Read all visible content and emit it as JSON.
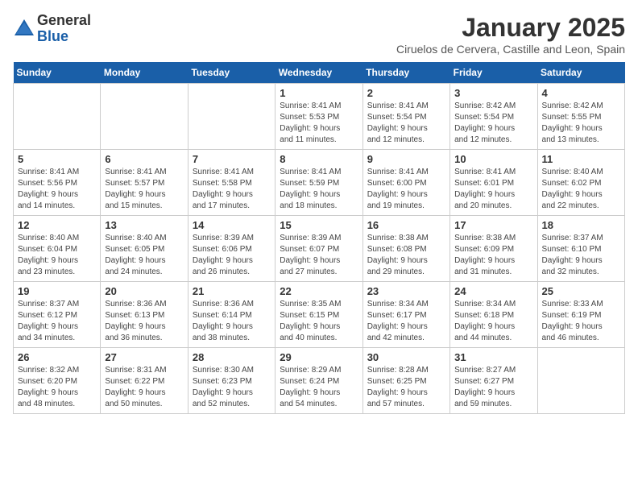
{
  "header": {
    "logo_general": "General",
    "logo_blue": "Blue",
    "month": "January 2025",
    "location": "Ciruelos de Cervera, Castille and Leon, Spain"
  },
  "weekdays": [
    "Sunday",
    "Monday",
    "Tuesday",
    "Wednesday",
    "Thursday",
    "Friday",
    "Saturday"
  ],
  "weeks": [
    [
      {
        "day": "",
        "info": ""
      },
      {
        "day": "",
        "info": ""
      },
      {
        "day": "",
        "info": ""
      },
      {
        "day": "1",
        "info": "Sunrise: 8:41 AM\nSunset: 5:53 PM\nDaylight: 9 hours\nand 11 minutes."
      },
      {
        "day": "2",
        "info": "Sunrise: 8:41 AM\nSunset: 5:54 PM\nDaylight: 9 hours\nand 12 minutes."
      },
      {
        "day": "3",
        "info": "Sunrise: 8:42 AM\nSunset: 5:54 PM\nDaylight: 9 hours\nand 12 minutes."
      },
      {
        "day": "4",
        "info": "Sunrise: 8:42 AM\nSunset: 5:55 PM\nDaylight: 9 hours\nand 13 minutes."
      }
    ],
    [
      {
        "day": "5",
        "info": "Sunrise: 8:41 AM\nSunset: 5:56 PM\nDaylight: 9 hours\nand 14 minutes."
      },
      {
        "day": "6",
        "info": "Sunrise: 8:41 AM\nSunset: 5:57 PM\nDaylight: 9 hours\nand 15 minutes."
      },
      {
        "day": "7",
        "info": "Sunrise: 8:41 AM\nSunset: 5:58 PM\nDaylight: 9 hours\nand 17 minutes."
      },
      {
        "day": "8",
        "info": "Sunrise: 8:41 AM\nSunset: 5:59 PM\nDaylight: 9 hours\nand 18 minutes."
      },
      {
        "day": "9",
        "info": "Sunrise: 8:41 AM\nSunset: 6:00 PM\nDaylight: 9 hours\nand 19 minutes."
      },
      {
        "day": "10",
        "info": "Sunrise: 8:41 AM\nSunset: 6:01 PM\nDaylight: 9 hours\nand 20 minutes."
      },
      {
        "day": "11",
        "info": "Sunrise: 8:40 AM\nSunset: 6:02 PM\nDaylight: 9 hours\nand 22 minutes."
      }
    ],
    [
      {
        "day": "12",
        "info": "Sunrise: 8:40 AM\nSunset: 6:04 PM\nDaylight: 9 hours\nand 23 minutes."
      },
      {
        "day": "13",
        "info": "Sunrise: 8:40 AM\nSunset: 6:05 PM\nDaylight: 9 hours\nand 24 minutes."
      },
      {
        "day": "14",
        "info": "Sunrise: 8:39 AM\nSunset: 6:06 PM\nDaylight: 9 hours\nand 26 minutes."
      },
      {
        "day": "15",
        "info": "Sunrise: 8:39 AM\nSunset: 6:07 PM\nDaylight: 9 hours\nand 27 minutes."
      },
      {
        "day": "16",
        "info": "Sunrise: 8:38 AM\nSunset: 6:08 PM\nDaylight: 9 hours\nand 29 minutes."
      },
      {
        "day": "17",
        "info": "Sunrise: 8:38 AM\nSunset: 6:09 PM\nDaylight: 9 hours\nand 31 minutes."
      },
      {
        "day": "18",
        "info": "Sunrise: 8:37 AM\nSunset: 6:10 PM\nDaylight: 9 hours\nand 32 minutes."
      }
    ],
    [
      {
        "day": "19",
        "info": "Sunrise: 8:37 AM\nSunset: 6:12 PM\nDaylight: 9 hours\nand 34 minutes."
      },
      {
        "day": "20",
        "info": "Sunrise: 8:36 AM\nSunset: 6:13 PM\nDaylight: 9 hours\nand 36 minutes."
      },
      {
        "day": "21",
        "info": "Sunrise: 8:36 AM\nSunset: 6:14 PM\nDaylight: 9 hours\nand 38 minutes."
      },
      {
        "day": "22",
        "info": "Sunrise: 8:35 AM\nSunset: 6:15 PM\nDaylight: 9 hours\nand 40 minutes."
      },
      {
        "day": "23",
        "info": "Sunrise: 8:34 AM\nSunset: 6:17 PM\nDaylight: 9 hours\nand 42 minutes."
      },
      {
        "day": "24",
        "info": "Sunrise: 8:34 AM\nSunset: 6:18 PM\nDaylight: 9 hours\nand 44 minutes."
      },
      {
        "day": "25",
        "info": "Sunrise: 8:33 AM\nSunset: 6:19 PM\nDaylight: 9 hours\nand 46 minutes."
      }
    ],
    [
      {
        "day": "26",
        "info": "Sunrise: 8:32 AM\nSunset: 6:20 PM\nDaylight: 9 hours\nand 48 minutes."
      },
      {
        "day": "27",
        "info": "Sunrise: 8:31 AM\nSunset: 6:22 PM\nDaylight: 9 hours\nand 50 minutes."
      },
      {
        "day": "28",
        "info": "Sunrise: 8:30 AM\nSunset: 6:23 PM\nDaylight: 9 hours\nand 52 minutes."
      },
      {
        "day": "29",
        "info": "Sunrise: 8:29 AM\nSunset: 6:24 PM\nDaylight: 9 hours\nand 54 minutes."
      },
      {
        "day": "30",
        "info": "Sunrise: 8:28 AM\nSunset: 6:25 PM\nDaylight: 9 hours\nand 57 minutes."
      },
      {
        "day": "31",
        "info": "Sunrise: 8:27 AM\nSunset: 6:27 PM\nDaylight: 9 hours\nand 59 minutes."
      },
      {
        "day": "",
        "info": ""
      }
    ]
  ]
}
